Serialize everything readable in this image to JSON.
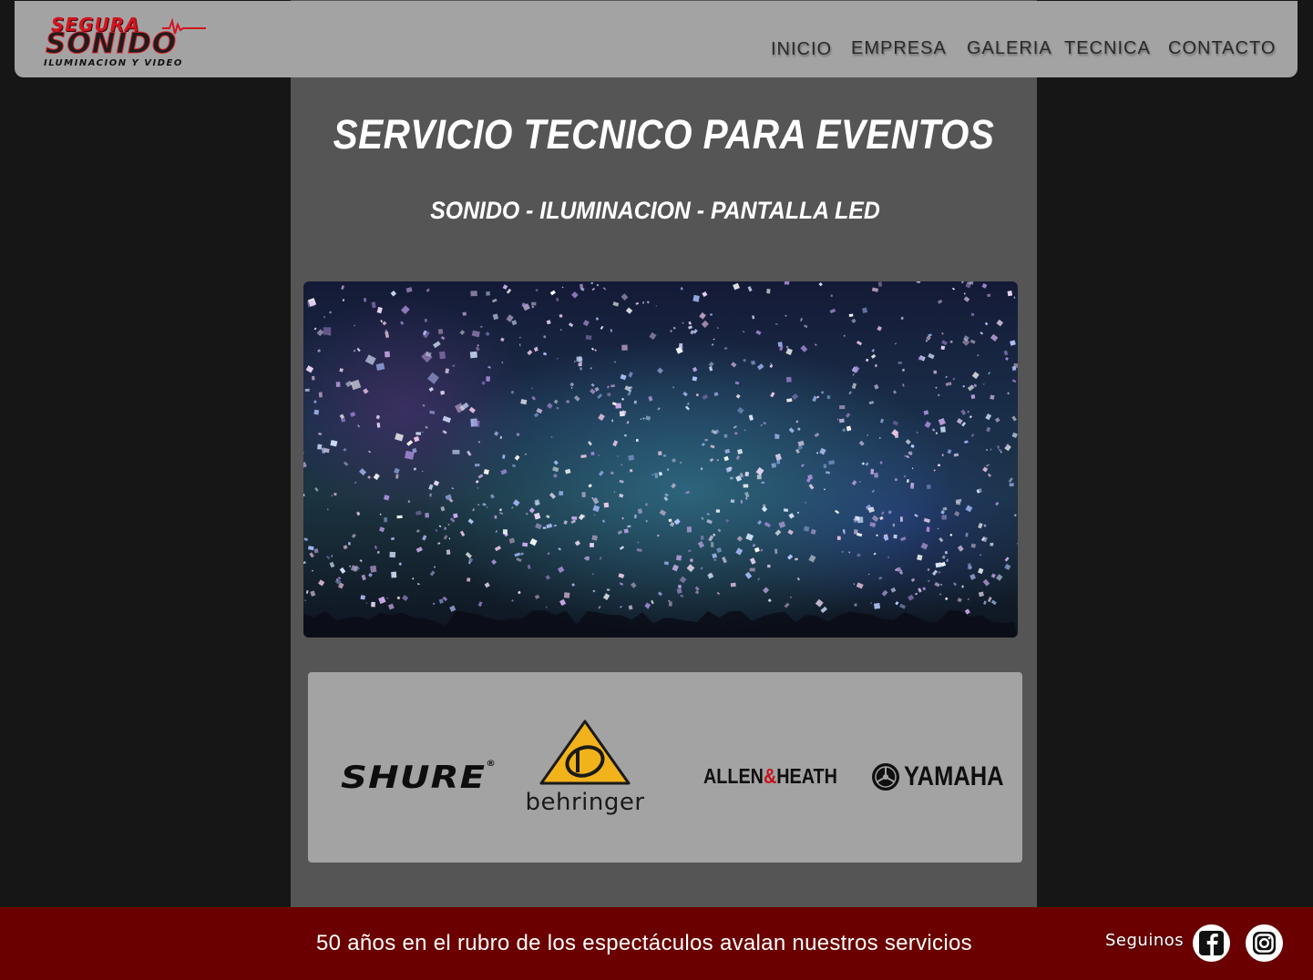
{
  "header": {
    "logo": {
      "line1": "SEGURA",
      "line2": "SONIDO",
      "tagline": "ILUMINACION Y VIDEO"
    },
    "nav": [
      {
        "label": "INICIO"
      },
      {
        "label": "EMPRESA"
      },
      {
        "label": "GALERIA"
      },
      {
        "label": "TECNICA"
      },
      {
        "label": "CONTACTO"
      }
    ]
  },
  "main": {
    "title": "SERVICIO TECNICO PARA EVENTOS",
    "subtitle": "SONIDO - ILUMINACION - PANTALLA LED",
    "hero_image": "concert-confetti-photo"
  },
  "brands": {
    "shure": "SHURE",
    "shure_mark": "®",
    "behringer": "behringer",
    "allen_heath": {
      "allen": "ALLEN",
      "amp": "&",
      "heath": "HEATH"
    },
    "yamaha": "YAMAHA"
  },
  "footer": {
    "tagline": "50 años en el rubro de los espectáculos avalan nuestros servicios",
    "follow_label": "Seguinos",
    "social": [
      {
        "icon": "facebook-icon"
      },
      {
        "icon": "instagram-icon"
      }
    ]
  },
  "colors": {
    "page_bg": "#161617",
    "column_bg": "#555555",
    "header_bg": "#a3a3a3",
    "brand_red": "#d3141f",
    "footer_bg": "#6a0000",
    "behringer_yellow": "#f2b21c"
  }
}
